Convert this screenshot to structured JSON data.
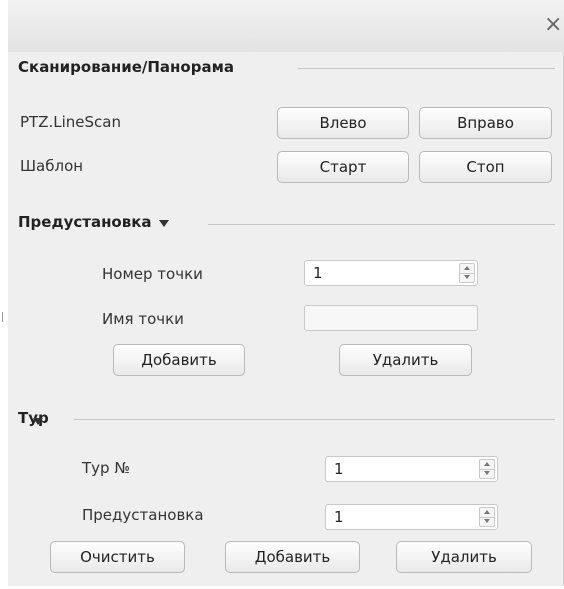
{
  "window": {
    "close_glyph": "×"
  },
  "scan": {
    "title": "Сканирование/Панорама",
    "linescan_label": "PTZ.LineScan",
    "left_button": "Влево",
    "right_button": "Вправо",
    "pattern_label": "Шаблон",
    "start_button": "Старт",
    "stop_button": "Стоп"
  },
  "preset": {
    "title": "Предустановка",
    "point_number_label": "Номер точки",
    "point_number_value": "1",
    "point_name_label": "Имя точки",
    "point_name_value": "",
    "add_button": "Добавить",
    "delete_button": "Удалить"
  },
  "tour": {
    "title": "Тур",
    "tour_number_label": "Тур №",
    "tour_number_value": "1",
    "preset_label": "Предустановка",
    "preset_value": "1",
    "clear_button": "Очистить",
    "add_button": "Добавить",
    "delete_button": "Удалить"
  },
  "icons": {
    "close": "close-icon",
    "spin_up": "chevron-up-icon",
    "spin_down": "chevron-down-icon",
    "collapse": "collapse-arrow-icon"
  }
}
